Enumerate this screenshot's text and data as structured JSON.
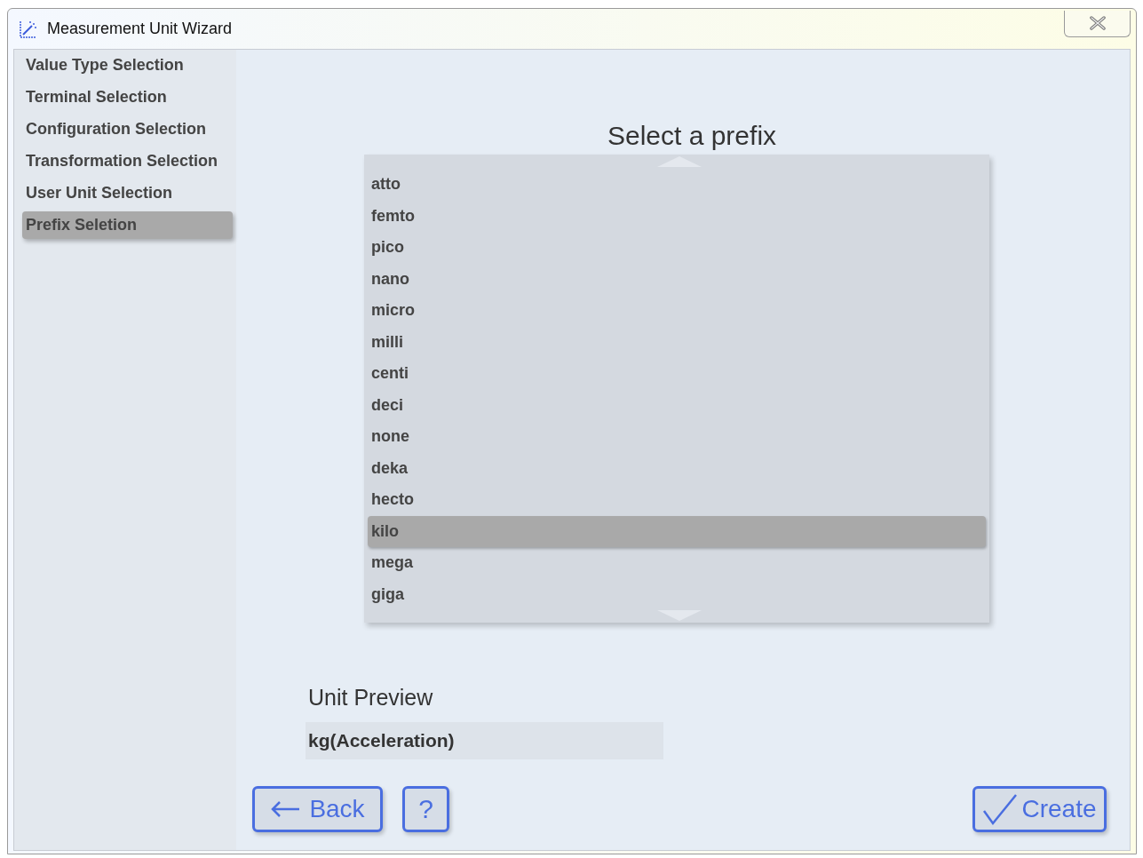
{
  "window": {
    "title": "Measurement Unit Wizard"
  },
  "steps": [
    {
      "label": "Value Type Selection",
      "selected": false
    },
    {
      "label": "Terminal Selection",
      "selected": false
    },
    {
      "label": "Configuration Selection",
      "selected": false
    },
    {
      "label": "Transformation Selection",
      "selected": false
    },
    {
      "label": "User Unit Selection",
      "selected": false
    },
    {
      "label": "Prefix Seletion",
      "selected": true
    }
  ],
  "heading": "Select a prefix",
  "prefixes": [
    {
      "label": "atto",
      "selected": false
    },
    {
      "label": "femto",
      "selected": false
    },
    {
      "label": "pico",
      "selected": false
    },
    {
      "label": "nano",
      "selected": false
    },
    {
      "label": "micro",
      "selected": false
    },
    {
      "label": "milli",
      "selected": false
    },
    {
      "label": "centi",
      "selected": false
    },
    {
      "label": "deci",
      "selected": false
    },
    {
      "label": "none",
      "selected": false
    },
    {
      "label": "deka",
      "selected": false
    },
    {
      "label": "hecto",
      "selected": false
    },
    {
      "label": "kilo",
      "selected": true
    },
    {
      "label": "mega",
      "selected": false
    },
    {
      "label": "giga",
      "selected": false
    }
  ],
  "preview": {
    "label": "Unit Preview",
    "value": "kg(Acceleration)"
  },
  "buttons": {
    "back": "Back",
    "help": "?",
    "create": "Create"
  }
}
